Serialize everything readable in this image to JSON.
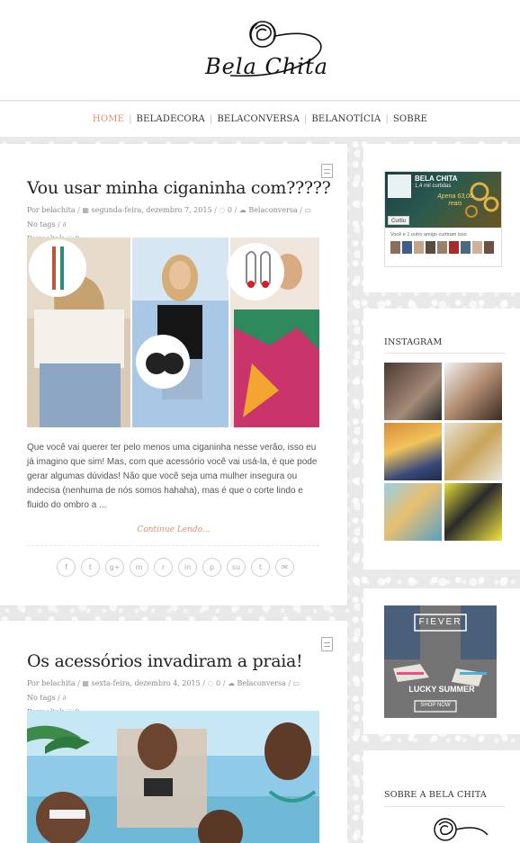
{
  "site": {
    "logo_text": "Bela Chita"
  },
  "nav": {
    "items": [
      {
        "label": "HOME",
        "active": true
      },
      {
        "label": "BELADECORA",
        "active": false
      },
      {
        "label": "BELACONVERSA",
        "active": false
      },
      {
        "label": "BELANOTÍCIA",
        "active": false
      },
      {
        "label": "SOBRE",
        "active": false
      }
    ],
    "accent_color": "#e98b6d"
  },
  "posts": [
    {
      "title": "Vou usar minha ciganinha com?????",
      "author": "Por belachita",
      "date": "segunda-feira, dezembro 7, 2015",
      "comments": "0",
      "category": "Belaconversa",
      "tags": "No tags",
      "permalink": "Permalink",
      "likes": "0",
      "excerpt": "Que você vai querer ter pelo menos uma ciganinha nesse verão, isso eu já imagino que sim! Mas, com que acessório você vai usá-la, é que pode gerar algumas dúvidas! Não que você seja uma mulher insegura ou indecisa (nenhuma de nós somos hahaha), mas é que o corte lindo e fluido do ombro a ...",
      "continue": "Continue Lendo..."
    },
    {
      "title": "Os acessórios invadiram a praia!",
      "author": "Por belachita",
      "date": "sexta-feira, dezembro 4, 2015",
      "comments": "0",
      "category": "Belaconversa",
      "tags": "No tags",
      "permalink": "Permalink",
      "likes": "0"
    }
  ],
  "share_icons": [
    "facebook-icon",
    "twitter-icon",
    "google-plus-icon",
    "myspace-icon",
    "reddit-icon",
    "linkedin-icon",
    "pinterest-icon",
    "stumbleupon-icon",
    "tumblr-icon",
    "email-icon"
  ],
  "share_glyphs": [
    "f",
    "t",
    "g+",
    "m",
    "r",
    "in",
    "p",
    "su",
    "t",
    "✉"
  ],
  "sidebar": {
    "facebook": {
      "page_name": "BELA CHITA",
      "likes": "1,4 mil curtidas",
      "promo": "Apena 63,00 reais",
      "like_button": "Curtiu",
      "friends_text": "Você e 1 outro amigo curtiram isso"
    },
    "instagram": {
      "title": "INSTAGRAM"
    },
    "ad": {
      "brand": "FIEVER",
      "headline": "LUCKY SUMMER",
      "cta": "SHOP NOW"
    },
    "about": {
      "title": "SOBRE A BELA CHITA"
    }
  }
}
